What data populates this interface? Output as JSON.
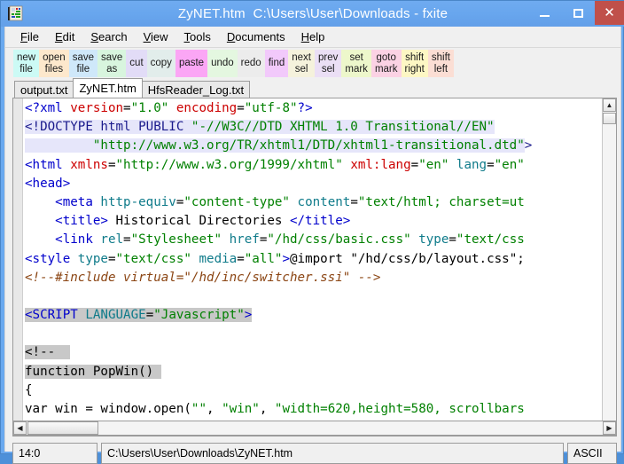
{
  "window": {
    "title": "ZyNET.htm  C:\\Users\\User\\Downloads - fxite",
    "icon": "document-icon",
    "minimize_label": "–",
    "maximize_label": "□",
    "close_label": "✕",
    "accent_titlebar": "#6aa9ef",
    "accent_close": "#c0504a"
  },
  "menubar": {
    "items": [
      {
        "accel": "F",
        "rest": "ile"
      },
      {
        "accel": "E",
        "rest": "dit"
      },
      {
        "accel": "S",
        "rest": "earch"
      },
      {
        "accel": "V",
        "rest": "iew"
      },
      {
        "accel": "T",
        "rest": "ools"
      },
      {
        "accel": "D",
        "rest": "ocuments"
      },
      {
        "accel": "H",
        "rest": "elp"
      }
    ]
  },
  "toolbar": {
    "buttons": [
      {
        "line1": "new",
        "line2": "file",
        "bg": "#ccfaf5"
      },
      {
        "line1": "open",
        "line2": "files",
        "bg": "#fde8cc"
      },
      {
        "line1": "save",
        "line2": "file",
        "bg": "#cfe8fa"
      },
      {
        "line1": "save",
        "line2": "as",
        "bg": "#d8f5de"
      },
      {
        "line1": "cut",
        "line2": "",
        "bg": "#e2dcf7"
      },
      {
        "line1": "copy",
        "line2": "",
        "bg": "#e2edeb"
      },
      {
        "line1": "paste",
        "line2": "",
        "bg": "#fba6f5"
      },
      {
        "line1": "undo",
        "line2": "",
        "bg": "#e4f7e0"
      },
      {
        "line1": "redo",
        "line2": "",
        "bg": "#ececec"
      },
      {
        "line1": "find",
        "line2": "",
        "bg": "#f2c9fb"
      },
      {
        "line1": "next",
        "line2": "sel",
        "bg": "#f5f2dc"
      },
      {
        "line1": "prev",
        "line2": "sel",
        "bg": "#ebdff5"
      },
      {
        "line1": "set",
        "line2": "mark",
        "bg": "#edf7cb"
      },
      {
        "line1": "goto",
        "line2": "mark",
        "bg": "#fbd2e4"
      },
      {
        "line1": "shift",
        "line2": "right",
        "bg": "#fdf7c4"
      },
      {
        "line1": "shift",
        "line2": "left",
        "bg": "#fbded4"
      }
    ]
  },
  "tabs": [
    {
      "label": "output.txt",
      "active": false
    },
    {
      "label": "ZyNET.htm",
      "active": true
    },
    {
      "label": "HfsReader_Log.txt",
      "active": false
    }
  ],
  "editor": {
    "lines": [
      [
        {
          "t": "<?xml ",
          "c": "tag"
        },
        {
          "t": "version",
          "c": "attr"
        },
        {
          "t": "=",
          "c": "plain"
        },
        {
          "t": "\"1.0\"",
          "c": "val"
        },
        {
          "t": " ",
          "c": "plain"
        },
        {
          "t": "encoding",
          "c": "attr"
        },
        {
          "t": "=",
          "c": "plain"
        },
        {
          "t": "\"utf-8\"",
          "c": "val"
        },
        {
          "t": "?>",
          "c": "tag"
        }
      ],
      [
        {
          "t": "<!DOCTYPE html PUBLIC ",
          "c": "tagdk hl-doctype"
        },
        {
          "t": "\"-//W3C//DTD XHTML 1.0 Transitional//EN\"",
          "c": "val hl-doctype"
        }
      ],
      [
        {
          "t": "         ",
          "c": "plain hl-doctype"
        },
        {
          "t": "\"http://www.w3.org/TR/xhtml1/DTD/xhtml1-transitional.dtd\"",
          "c": "val hl-doctype"
        },
        {
          "t": ">",
          "c": "tagdk"
        }
      ],
      [
        {
          "t": "<html ",
          "c": "tag"
        },
        {
          "t": "xmlns",
          "c": "attr"
        },
        {
          "t": "=",
          "c": "plain"
        },
        {
          "t": "\"http://www.w3.org/1999/xhtml\"",
          "c": "val"
        },
        {
          "t": " ",
          "c": "plain"
        },
        {
          "t": "xml:lang",
          "c": "attr"
        },
        {
          "t": "=",
          "c": "plain"
        },
        {
          "t": "\"en\"",
          "c": "val"
        },
        {
          "t": " ",
          "c": "plain"
        },
        {
          "t": "lang",
          "c": "attr2"
        },
        {
          "t": "=",
          "c": "plain"
        },
        {
          "t": "\"en\"",
          "c": "val"
        }
      ],
      [
        {
          "t": "<head>",
          "c": "tag"
        }
      ],
      [
        {
          "t": "    <meta ",
          "c": "tag"
        },
        {
          "t": "http-equiv",
          "c": "attr2"
        },
        {
          "t": "=",
          "c": "plain"
        },
        {
          "t": "\"content-type\"",
          "c": "val"
        },
        {
          "t": " ",
          "c": "plain"
        },
        {
          "t": "content",
          "c": "attr2"
        },
        {
          "t": "=",
          "c": "plain"
        },
        {
          "t": "\"text/html; charset=ut",
          "c": "val"
        }
      ],
      [
        {
          "t": "    <title>",
          "c": "tag"
        },
        {
          "t": " Historical Directories ",
          "c": "plain"
        },
        {
          "t": "</title>",
          "c": "tag"
        }
      ],
      [
        {
          "t": "    <link ",
          "c": "tag"
        },
        {
          "t": "rel",
          "c": "attr2"
        },
        {
          "t": "=",
          "c": "plain"
        },
        {
          "t": "\"Stylesheet\"",
          "c": "val"
        },
        {
          "t": " ",
          "c": "plain"
        },
        {
          "t": "href",
          "c": "attr2"
        },
        {
          "t": "=",
          "c": "plain"
        },
        {
          "t": "\"/hd/css/basic.css\"",
          "c": "val"
        },
        {
          "t": " ",
          "c": "plain"
        },
        {
          "t": "type",
          "c": "attr2"
        },
        {
          "t": "=",
          "c": "plain"
        },
        {
          "t": "\"text/css",
          "c": "val"
        }
      ],
      [
        {
          "t": "<style ",
          "c": "tag"
        },
        {
          "t": "type",
          "c": "attr2"
        },
        {
          "t": "=",
          "c": "plain"
        },
        {
          "t": "\"text/css\"",
          "c": "val"
        },
        {
          "t": " ",
          "c": "plain"
        },
        {
          "t": "media",
          "c": "attr2"
        },
        {
          "t": "=",
          "c": "plain"
        },
        {
          "t": "\"all\"",
          "c": "val"
        },
        {
          "t": ">",
          "c": "tag"
        },
        {
          "t": "@import \"/hd/css/b/layout.css\";",
          "c": "plain"
        }
      ],
      [
        {
          "t": "<!--#include virtual=\"/hd/inc/switcher.ssi\" -->",
          "c": "comment"
        }
      ],
      [
        {
          "t": "",
          "c": "plain"
        }
      ],
      [
        {
          "t": "<SCRIPT ",
          "c": "tag hl-sel"
        },
        {
          "t": "LANGUAGE",
          "c": "attr2 hl-sel"
        },
        {
          "t": "=",
          "c": "plain hl-sel"
        },
        {
          "t": "\"Javascript\"",
          "c": "val hl-sel"
        },
        {
          "t": ">",
          "c": "tag hl-sel"
        }
      ],
      [
        {
          "t": "",
          "c": "plain"
        }
      ],
      [
        {
          "t": "<!--",
          "c": "plain hl-sel"
        },
        {
          "t": "  ",
          "c": "plain hl-sel"
        }
      ],
      [
        {
          "t": "function PopWin()",
          "c": "plain hl-sel"
        },
        {
          "t": " ",
          "c": "plain hl-sel"
        }
      ],
      [
        {
          "t": "{",
          "c": "plain"
        }
      ],
      [
        {
          "t": "var win = window.open(",
          "c": "plain"
        },
        {
          "t": "\"\"",
          "c": "val"
        },
        {
          "t": ", ",
          "c": "plain"
        },
        {
          "t": "\"win\"",
          "c": "val"
        },
        {
          "t": ", ",
          "c": "plain"
        },
        {
          "t": "\"width=620,height=580, scrollbars",
          "c": "val"
        }
      ]
    ]
  },
  "scrollbars": {
    "v_up": "▲",
    "v_down": "▼",
    "h_left": "◀",
    "h_right": "▶"
  },
  "statusbar": {
    "position": "14:0",
    "path": "C:\\Users\\User\\Downloads\\ZyNET.htm",
    "encoding": "ASCII"
  }
}
